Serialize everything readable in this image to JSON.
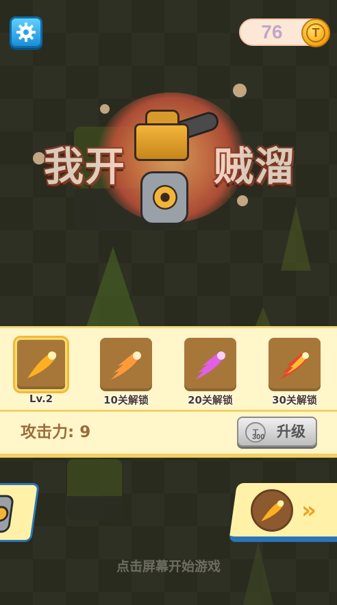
{
  "coins": {
    "count": "76",
    "icon_symbol": "T"
  },
  "settings": {
    "icon": "gear-icon"
  },
  "title": {
    "left": "我开",
    "right": "贼溜"
  },
  "weapons": [
    {
      "label": "Lv.2",
      "color": "#ffb020",
      "selected": true
    },
    {
      "label": "10关解锁",
      "color": "#ff9a3a",
      "selected": false
    },
    {
      "label": "20关解锁",
      "color": "#e060e8",
      "selected": false
    },
    {
      "label": "30关解锁",
      "color": "#ffbe30",
      "selected": false
    }
  ],
  "attack": {
    "label": "攻击力: 9"
  },
  "upgrade": {
    "label": "升级",
    "cost": "300",
    "coin_symbol": "T"
  },
  "next_arrows": "»",
  "hint": "点击屏幕开始游戏",
  "colors": {
    "panel_bg": "#fff6c9",
    "slot_bg": "#a7773a",
    "accent_blue": "#2b74b8",
    "coin_gold": "#f3a515"
  }
}
